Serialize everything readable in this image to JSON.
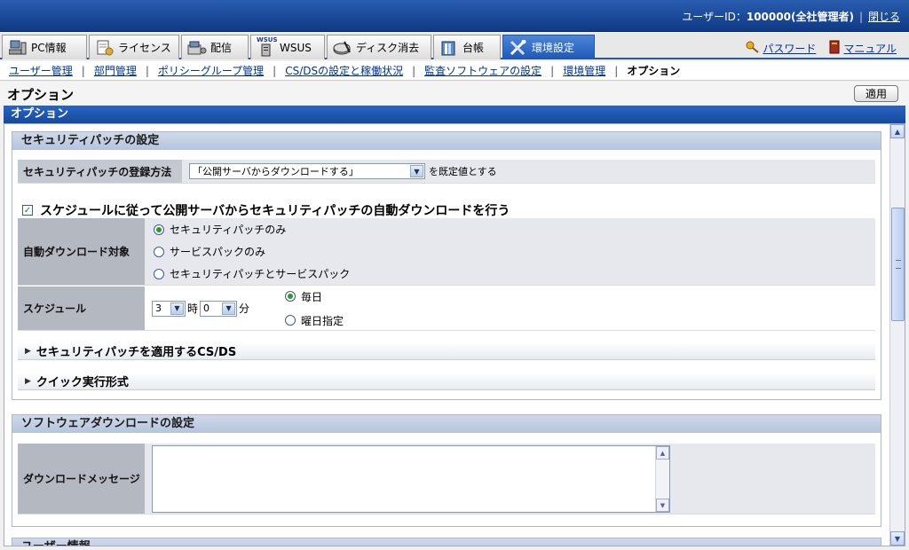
{
  "header": {
    "user_label": "ユーザーID：",
    "user_value": "100000(全社管理者)",
    "close_label": "閉じる"
  },
  "tabs": [
    {
      "label": "PC情報",
      "icon": "pc-icon"
    },
    {
      "label": "ライセンス",
      "icon": "license-icon"
    },
    {
      "label": "配信",
      "icon": "distribution-icon"
    },
    {
      "label": "WSUS",
      "icon": "wsus-icon"
    },
    {
      "label": "ディスク消去",
      "icon": "disk-erase-icon"
    },
    {
      "label": "台帳",
      "icon": "ledger-icon"
    },
    {
      "label": "環境設定",
      "icon": "tools-icon"
    }
  ],
  "tab_wsus_badge": "WSUS",
  "right_links": {
    "password": "パスワード",
    "manual": "マニュアル"
  },
  "subnav": [
    "ユーザー管理",
    "部門管理",
    "ポリシーグループ管理",
    "CS/DSの設定と稼働状況",
    "監査ソフトウェアの設定",
    "環境管理",
    "オプション"
  ],
  "page": {
    "title": "オプション",
    "apply": "適用",
    "section": "オプション"
  },
  "security": {
    "title": "セキュリティパッチの設定",
    "reg_label": "セキュリティパッチの登録方法",
    "reg_value": "「公開サーバからダウンロードする」",
    "reg_suffix": "を既定値とする",
    "auto_check": "スケジュールに従って公開サーバからセキュリティパッチの自動ダウンロードを行う",
    "target_label": "自動ダウンロード対象",
    "target_options": [
      "セキュリティパッチのみ",
      "サービスパックのみ",
      "セキュリティパッチとサービスパック"
    ],
    "schedule_label": "スケジュール",
    "hour_value": "3",
    "hour_unit": "時",
    "minute_value": "0",
    "minute_unit": "分",
    "schedule_options": [
      "毎日",
      "曜日指定"
    ],
    "apply_csds": "セキュリティパッチを適用するCS/DS",
    "quick": "クイック実行形式"
  },
  "software": {
    "title": "ソフトウェアダウンロードの設定",
    "msg_label": "ダウンロードメッセージ",
    "msg_value": ""
  },
  "user_info_partial": "ユーザー情報"
}
